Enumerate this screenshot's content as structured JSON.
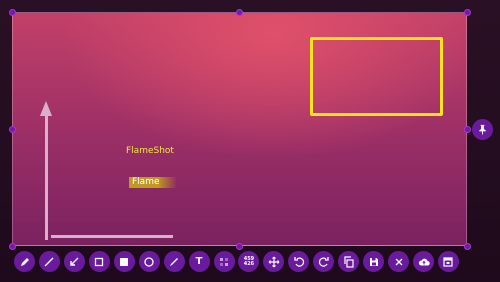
{
  "canvas": {
    "annotations": {
      "text_label": "FlameShot",
      "marker_label": "Flame"
    },
    "colors": {
      "selection_border": "#7a16a8",
      "rectangle": "#f5e31a",
      "arrow": "#d8b0cc",
      "text": "#f2e640",
      "toolbar_button": "#6a1a9c"
    }
  },
  "side_buttons": {
    "pin_icon": "pin-icon"
  },
  "toolbar": {
    "buttons": [
      {
        "name": "pencil",
        "icon": "pencil-icon"
      },
      {
        "name": "line",
        "icon": "line-icon"
      },
      {
        "name": "arrow",
        "icon": "arrow-icon"
      },
      {
        "name": "rectangle",
        "icon": "rectangle-icon"
      },
      {
        "name": "filled-rectangle",
        "icon": "filled-rectangle-icon"
      },
      {
        "name": "circle",
        "icon": "circle-icon"
      },
      {
        "name": "marker",
        "icon": "marker-icon"
      },
      {
        "name": "text",
        "icon": "text-icon",
        "glyph": "T"
      },
      {
        "name": "pixelate",
        "icon": "pixelate-icon"
      },
      {
        "name": "selection-size",
        "icon": "selection-size-icon",
        "glyph": "459\n426"
      },
      {
        "name": "move",
        "icon": "move-icon"
      },
      {
        "name": "undo",
        "icon": "undo-icon"
      },
      {
        "name": "redo",
        "icon": "redo-icon"
      },
      {
        "name": "copy",
        "icon": "copy-icon"
      },
      {
        "name": "save",
        "icon": "save-icon"
      },
      {
        "name": "exit",
        "icon": "close-icon"
      },
      {
        "name": "upload",
        "icon": "upload-icon"
      },
      {
        "name": "app-launcher",
        "icon": "app-launcher-icon"
      }
    ]
  }
}
